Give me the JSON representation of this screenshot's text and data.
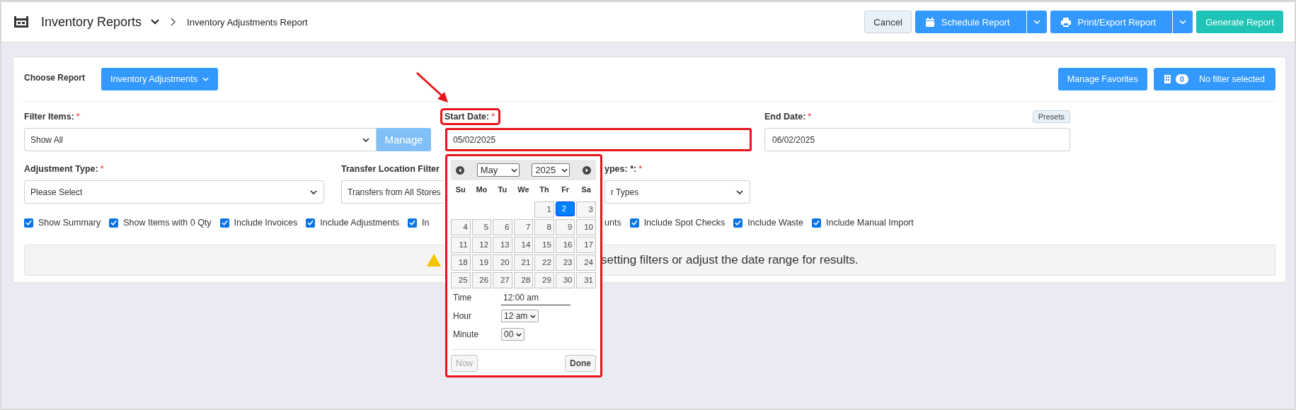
{
  "header": {
    "title": "Inventory Reports",
    "breadcrumb": "Inventory Adjustments Report",
    "buttons": [
      {
        "label": "Cancel",
        "kind": "plain"
      },
      {
        "label": "Schedule Report",
        "kind": "schedule"
      },
      {
        "label": "Print/Export Report",
        "kind": "print"
      },
      {
        "label": "Generate Report",
        "kind": "primary"
      }
    ]
  },
  "report_bar": {
    "label": "Choose Report",
    "report": "Inventory Adjustments",
    "favorites_button": "Manage Favorites",
    "filter_count": "0",
    "filter_status": "No filter selected"
  },
  "filters": {
    "filter_items": {
      "label": "Filter Items:",
      "required_mark": "*",
      "value": "Show All",
      "button": "Manage"
    },
    "start_date": {
      "label": "Start Date:",
      "required_mark": "*",
      "value": "05/02/2025",
      "highlighted": true,
      "pointed": true
    },
    "end_date": {
      "label": "End Date:",
      "required_mark": "*",
      "value": "06/02/2025",
      "presets": "Presets"
    },
    "adjustment_type": {
      "label": "Adjustment Type:",
      "required_mark": "*",
      "value": "Please Select"
    },
    "transfer_location": {
      "label": "Transfer Location Filter",
      "value": "Transfers from All Stores"
    },
    "column_3": {
      "label": "ypes: *:",
      "required_mark": "*",
      "value": "r Types"
    }
  },
  "options": [
    {
      "kind": "checkbox",
      "label": "Show Summary",
      "checked": true
    },
    {
      "kind": "checkbox",
      "label": "Show Items with 0 Qty",
      "checked": true
    },
    {
      "kind": "checkbox",
      "label": "Include Invoices",
      "checked": true
    },
    {
      "kind": "checkbox",
      "label": "Include Adjustments",
      "checked": true
    },
    {
      "kind": "checkbox",
      "label": "In",
      "checked": true
    },
    {
      "kind": "cut",
      "label": "unts"
    },
    {
      "kind": "checkbox",
      "label": "Include Spot Checks",
      "checked": true
    },
    {
      "kind": "checkbox",
      "label": "Include Waste",
      "checked": true
    },
    {
      "kind": "checkbox",
      "label": "Include Manual Import",
      "checked": true
    }
  ],
  "notice": "setting filters or adjust the date range for results.",
  "date_picker": {
    "highlighted": true,
    "month": "May",
    "year": "2025",
    "weekdays": [
      "Su",
      "Mo",
      "Tu",
      "We",
      "Th",
      "Fr",
      "Sa"
    ],
    "days": [
      {
        "kind": "blank"
      },
      {
        "kind": "blank"
      },
      {
        "kind": "blank"
      },
      {
        "kind": "blank"
      },
      {
        "kind": "day",
        "day": "1",
        "selected": false
      },
      {
        "kind": "day",
        "day": "2",
        "selected": true
      },
      {
        "kind": "day",
        "day": "3",
        "selected": false
      },
      {
        "kind": "day",
        "day": "4",
        "selected": false
      },
      {
        "kind": "day",
        "day": "5",
        "selected": false
      },
      {
        "kind": "day",
        "day": "6",
        "selected": false
      },
      {
        "kind": "day",
        "day": "7",
        "selected": false
      },
      {
        "kind": "day",
        "day": "8",
        "selected": false
      },
      {
        "kind": "day",
        "day": "9",
        "selected": false
      },
      {
        "kind": "day",
        "day": "10",
        "selected": false
      },
      {
        "kind": "day",
        "day": "11",
        "selected": false
      },
      {
        "kind": "day",
        "day": "12",
        "selected": false
      },
      {
        "kind": "day",
        "day": "13",
        "selected": false
      },
      {
        "kind": "day",
        "day": "14",
        "selected": false
      },
      {
        "kind": "day",
        "day": "15",
        "selected": false
      },
      {
        "kind": "day",
        "day": "16",
        "selected": false
      },
      {
        "kind": "day",
        "day": "17",
        "selected": false
      },
      {
        "kind": "day",
        "day": "18",
        "selected": false
      },
      {
        "kind": "day",
        "day": "19",
        "selected": false
      },
      {
        "kind": "day",
        "day": "20",
        "selected": false
      },
      {
        "kind": "day",
        "day": "21",
        "selected": false
      },
      {
        "kind": "day",
        "day": "22",
        "selected": false
      },
      {
        "kind": "day",
        "day": "23",
        "selected": false
      },
      {
        "kind": "day",
        "day": "24",
        "selected": false
      },
      {
        "kind": "day",
        "day": "25",
        "selected": false
      },
      {
        "kind": "day",
        "day": "26",
        "selected": false
      },
      {
        "kind": "day",
        "day": "27",
        "selected": false
      },
      {
        "kind": "day",
        "day": "28",
        "selected": false
      },
      {
        "kind": "day",
        "day": "29",
        "selected": false
      },
      {
        "kind": "day",
        "day": "30",
        "selected": false
      },
      {
        "kind": "day",
        "day": "31",
        "selected": false
      }
    ],
    "time_label": "Time",
    "time": "12:00 am",
    "hour_label": "Hour",
    "hour": "12 am",
    "minute_label": "Minute",
    "minute": "00",
    "now_button": {
      "label": "Now",
      "disabled": true
    },
    "done_button": "Done"
  }
}
